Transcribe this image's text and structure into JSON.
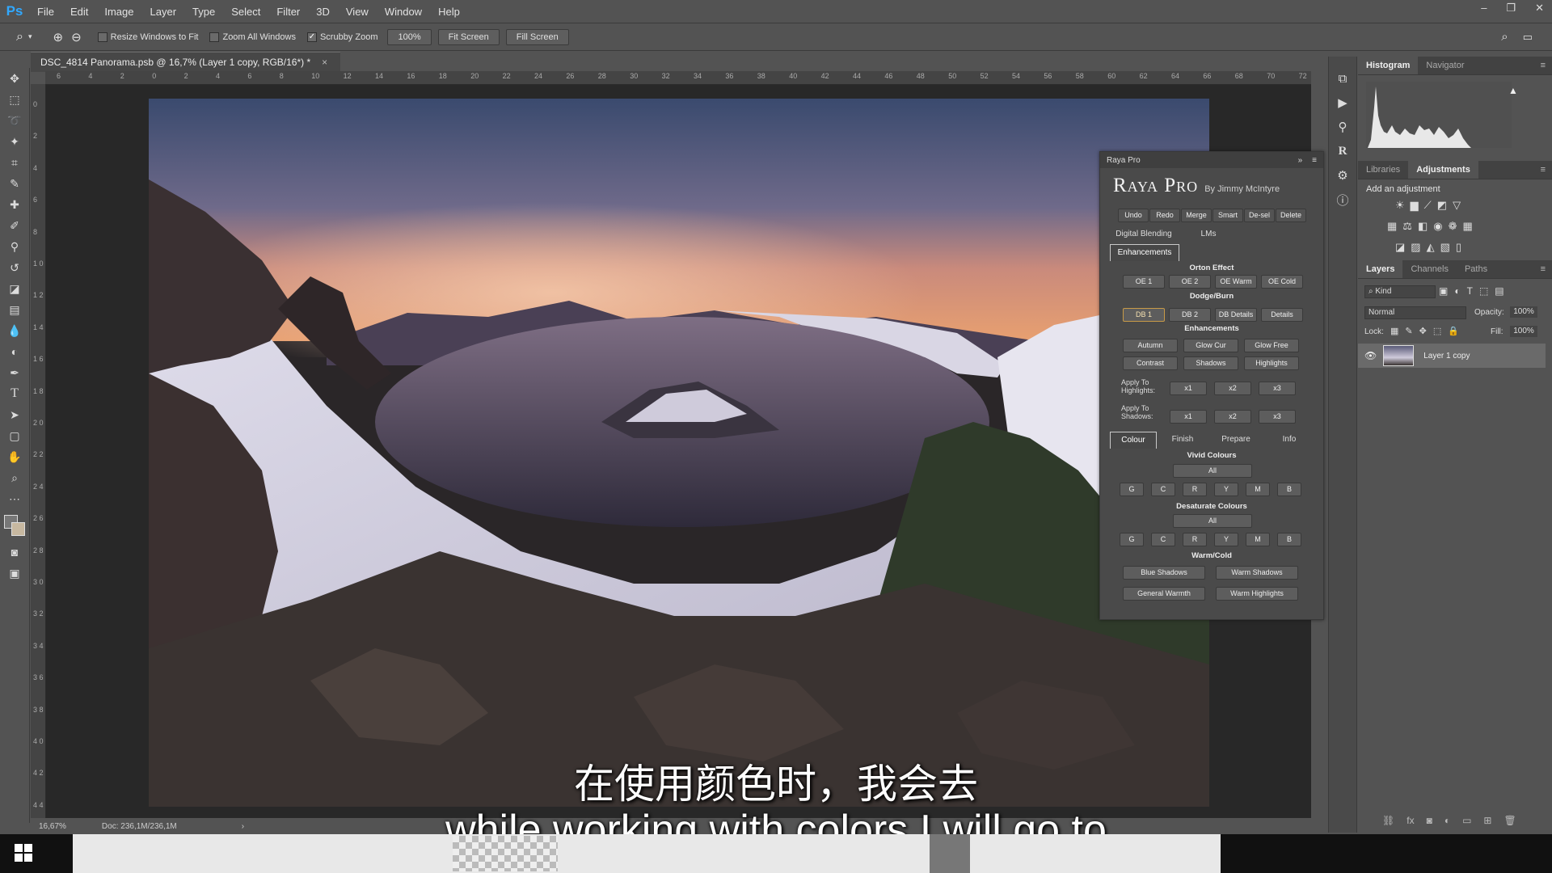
{
  "app": {
    "logo": "Ps",
    "menu": [
      "File",
      "Edit",
      "Image",
      "Layer",
      "Type",
      "Select",
      "Filter",
      "3D",
      "View",
      "Window",
      "Help"
    ],
    "window_controls": [
      "–",
      "❐",
      "✕"
    ]
  },
  "options_bar": {
    "resize_windows_label": "Resize Windows to Fit",
    "zoom_all_label": "Zoom All Windows",
    "scrubby_zoom_label": "Scrubby Zoom",
    "zoom_value": "100%",
    "fit_screen": "Fit Screen",
    "fill_screen": "Fill Screen"
  },
  "document": {
    "tab_title": "DSC_4814 Panorama.psb @ 16,7% (Layer 1 copy, RGB/16*) *",
    "zoom_status": "16,67%",
    "doc_status": "Doc: 236,1M/236,1M"
  },
  "ruler_top": [
    "6",
    "4",
    "2",
    "0",
    "2",
    "4",
    "6",
    "8",
    "10",
    "12",
    "14",
    "16",
    "18",
    "20",
    "22",
    "24",
    "26",
    "28",
    "30",
    "32",
    "34",
    "36",
    "38",
    "40",
    "42",
    "44",
    "46",
    "48",
    "50",
    "52",
    "54",
    "56",
    "58",
    "60",
    "62",
    "64",
    "66",
    "68",
    "70",
    "72"
  ],
  "ruler_left": [
    "0",
    "2",
    "4",
    "6",
    "8",
    "1 0",
    "1 2",
    "1 4",
    "1 6",
    "1 8",
    "2 0",
    "2 2",
    "2 4",
    "2 6",
    "2 8",
    "3 0",
    "3 2",
    "3 4",
    "3 6",
    "3 8",
    "4 0",
    "4 2",
    "4 4"
  ],
  "raya": {
    "panel_name": "Raya Pro",
    "title": "Raya Pro",
    "byline": "By Jimmy McIntyre",
    "top_buttons": [
      "Undo",
      "Redo",
      "Merge",
      "Smart",
      "De-sel",
      "Delete"
    ],
    "tabs1": [
      "Digital Blending",
      "LMs"
    ],
    "tab_enh": "Enhancements",
    "orton_label": "Orton Effect",
    "orton": [
      "OE 1",
      "OE 2",
      "OE Warm",
      "OE Cold"
    ],
    "dodge_label": "Dodge/Burn",
    "dodge": [
      "DB 1",
      "DB 2",
      "DB Details",
      "Details"
    ],
    "enh_label": "Enhancements",
    "enh_row1": [
      "Autumn",
      "Glow Cur",
      "Glow Free"
    ],
    "enh_row2": [
      "Contrast",
      "Shadows",
      "Highlights"
    ],
    "apply_highlights": "Apply To Highlights:",
    "apply_shadows": "Apply To Shadows:",
    "mult": [
      "x1",
      "x2",
      "x3"
    ],
    "tabs2": [
      "Colour",
      "Finish",
      "Prepare",
      "Info"
    ],
    "vivid_label": "Vivid Colours",
    "all": "All",
    "colors": [
      "G",
      "C",
      "R",
      "Y",
      "M",
      "B"
    ],
    "desat_label": "Desaturate Colours",
    "warm_label": "Warm/Cold",
    "warm_row1": [
      "Blue Shadows",
      "Warm Shadows"
    ],
    "warm_row2": [
      "General Warmth",
      "Warm Highlights"
    ]
  },
  "right": {
    "hist_tabs": [
      "Histogram",
      "Navigator"
    ],
    "adj_tabs": [
      "Libraries",
      "Adjustments"
    ],
    "add_adjustment": "Add an adjustment",
    "layer_tabs": [
      "Layers",
      "Channels",
      "Paths"
    ],
    "kind": "Kind",
    "blend_mode": "Normal",
    "opacity_label": "Opacity:",
    "opacity_value": "100%",
    "lock_label": "Lock:",
    "fill_label": "Fill:",
    "fill_value": "100%",
    "layer_name": "Layer 1 copy"
  },
  "subtitles": {
    "cn": "在使用颜色时，我会去",
    "en": "while working with colors I will go to"
  }
}
